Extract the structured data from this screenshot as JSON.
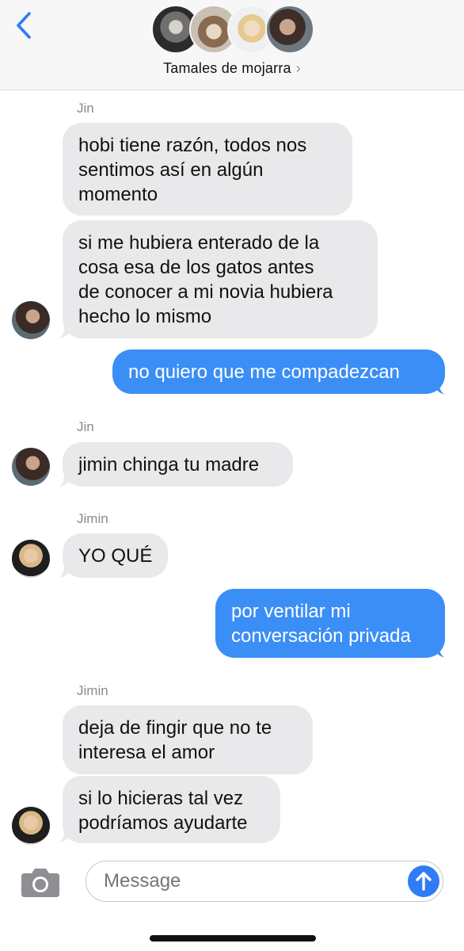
{
  "header": {
    "group_name": "Tamales de mojarra",
    "chevron": "›"
  },
  "messages": [
    {
      "sender": "Jin",
      "lines": [
        "hobi tiene razón, todos nos",
        "sentimos así en algún",
        "momento"
      ]
    },
    {
      "lines": [
        "si me hubiera enterado de la",
        "cosa esa de los gatos antes",
        "de conocer a mi novia hubiera",
        "hecho lo mismo"
      ]
    },
    {
      "lines": [
        "no quiero que me compadezcan"
      ]
    },
    {
      "sender": "Jin",
      "lines": [
        "jimin chinga tu madre"
      ]
    },
    {
      "sender": "Jimin",
      "lines": [
        "YO QUÉ"
      ]
    },
    {
      "lines": [
        "por ventilar mi",
        "conversación privada"
      ]
    },
    {
      "sender": "Jimin",
      "lines": [
        "deja de fingir que no te",
        "interesa el amor"
      ]
    },
    {
      "lines": [
        "si lo hicieras tal vez",
        "podríamos ayudarte"
      ]
    }
  ],
  "composer": {
    "placeholder": "Message"
  },
  "colors": {
    "outgoing": "#3b8ef5",
    "incoming": "#e9e9eb",
    "accent": "#2f7cf6"
  },
  "icons": [
    "back-chevron-icon",
    "camera-icon",
    "send-arrow-icon"
  ]
}
